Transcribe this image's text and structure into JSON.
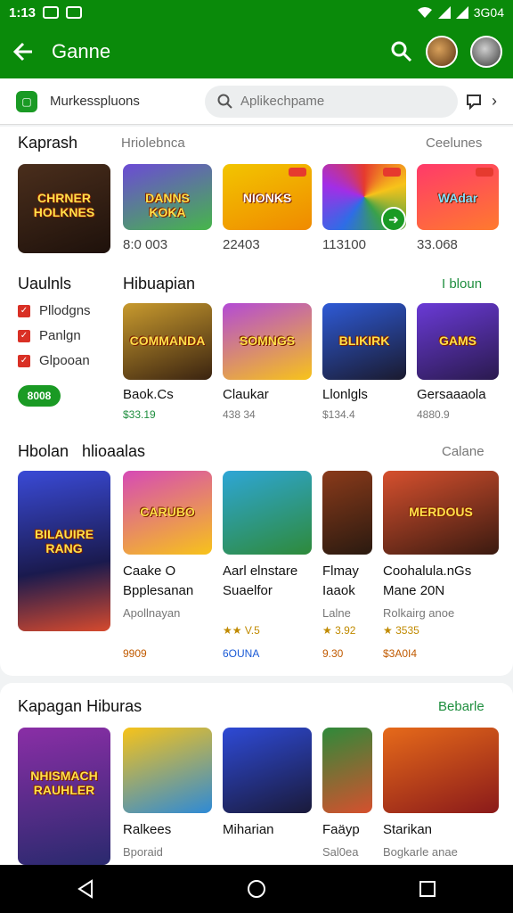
{
  "status": {
    "time": "1:13",
    "right": "3G04"
  },
  "appbar": {
    "title": "Ganne"
  },
  "subbar": {
    "store_label": "Murkesspluons",
    "search_placeholder": "Aplikechpame"
  },
  "colors": {
    "brand_green": "#0a8a0a",
    "accent_green": "#1e8e3e",
    "check_red": "#d93025"
  },
  "section1": {
    "title": "Kaprash",
    "subtitle": "Hriolebnca",
    "more": "Ceelunes",
    "featured_logo": "CHRNER HOLKNES",
    "items": [
      {
        "logo": "DANNS KOKA",
        "value": "8:0 003"
      },
      {
        "logo": "NIONKS",
        "value": "22403"
      },
      {
        "logo": "",
        "value": "113100"
      },
      {
        "logo": "WAdar",
        "value": "33.068"
      }
    ]
  },
  "section2": {
    "left_title": "Uaulnls",
    "checks": [
      "Pllodgns",
      "Panlgn",
      "Glpooan"
    ],
    "pill": "8008",
    "title": "Hibuapian",
    "more": "I bloun",
    "items": [
      {
        "logo": "COMMANDA",
        "name": "Baok.Cs",
        "value": "$33.19"
      },
      {
        "logo": "SOMNGS",
        "name": "Claukar",
        "value": "438 34"
      },
      {
        "logo": "BLIKIRK",
        "name": "Llonlgls",
        "value": "$134.4"
      },
      {
        "logo": "GAMS",
        "name": "Gersaaaola",
        "value": "4880.9"
      }
    ]
  },
  "section3": {
    "title": "Hbolan",
    "title2": "hlioaalas",
    "more": "Calane",
    "featured_logo": "BILAUIRE RANG",
    "items": [
      {
        "logo": "CARUBO",
        "line1": "Caake O",
        "line2": "Bpplesanan",
        "meta": "Apollnayan",
        "rating": "",
        "price": ""
      },
      {
        "logo": "",
        "line1": "Aarl elnstare",
        "line2": "Suaelfor",
        "meta": "",
        "rating": "★★ V.5",
        "price": "6OUNA"
      },
      {
        "logo": "",
        "line1": "Flmay",
        "line2": "Iaaok",
        "meta": "Lalne",
        "rating": "★ 3.92",
        "price": "9.30"
      },
      {
        "logo": "MERDOUS",
        "line1": "Coohalula.nGs",
        "line2": "Mane 20N",
        "meta": "Rolkairg anoe",
        "rating": "★ 3535",
        "price": "$3A0I4"
      }
    ],
    "first_price": "9909"
  },
  "section4": {
    "title": "Kapagan Hiburas",
    "more": "Bebarle",
    "featured_logo": "NHISMACH RAUHLER",
    "items": [
      {
        "name": "Ralkees",
        "meta": "Bporaid"
      },
      {
        "name": "Miharian",
        "meta": ""
      },
      {
        "name": "Faäyp",
        "meta": "Sal0ea"
      },
      {
        "name": "Starikan",
        "meta": "Bogkarle anae"
      }
    ]
  }
}
